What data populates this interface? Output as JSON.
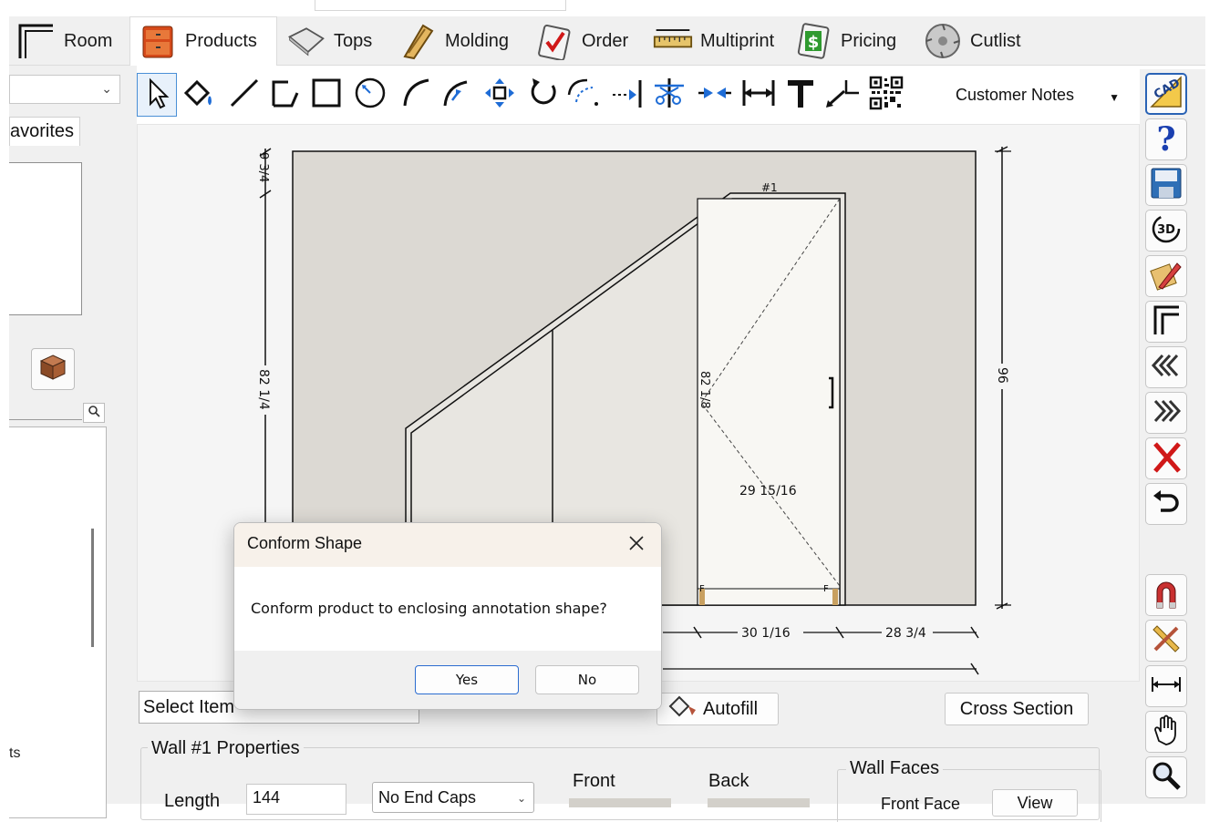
{
  "tabs": [
    {
      "label": "Room",
      "icon": "room-icon",
      "active": false
    },
    {
      "label": "Products",
      "icon": "products-cabinet-icon",
      "active": true
    },
    {
      "label": "Tops",
      "icon": "tops-icon",
      "active": false
    },
    {
      "label": "Molding",
      "icon": "molding-icon",
      "active": false
    },
    {
      "label": "Order",
      "icon": "order-clipboard-icon",
      "active": false
    },
    {
      "label": "Multiprint",
      "icon": "ruler-icon",
      "active": false
    },
    {
      "label": "Pricing",
      "icon": "pricing-dollar-icon",
      "active": false
    },
    {
      "label": "Cutlist",
      "icon": "saw-blade-icon",
      "active": false
    }
  ],
  "left_panel": {
    "favorites_tab": "avorites",
    "bottom_label": "ts"
  },
  "toolbar": {
    "notes_selected": "Customer Notes",
    "tools": [
      "select-arrow-icon",
      "paint-bucket-icon",
      "line-icon",
      "polyline-icon",
      "rectangle-icon",
      "circle-icon",
      "arc-icon",
      "arc-tangent-icon",
      "move-icon",
      "rotate-icon",
      "offset-icon",
      "extend-icon",
      "trim-icon",
      "join-icon",
      "dimension-icon",
      "text-icon",
      "leader-icon",
      "qr-code-icon"
    ]
  },
  "drawing": {
    "wall_label": "#1",
    "dim_left_top": "9 3/4",
    "dim_left": "82 1/4",
    "dim_right": "96",
    "dim_inner_height": "82 1/8",
    "dim_inner_width": "29 15/16",
    "dim_bottom_a": "30 1/16",
    "dim_bottom_b": "28 3/4",
    "corner_mark": "F",
    "colors": {
      "wall_fill": "#dcd9d3",
      "cabinet_fill": "#f8f7f3",
      "line": "#111111"
    }
  },
  "bottom": {
    "select_item": "Select Item",
    "autofill": "Autofill",
    "cross_section": "Cross Section",
    "props_title": "Wall #1 Properties",
    "length_label": "Length",
    "length_value": "144",
    "end_caps": "No End Caps",
    "front": "Front",
    "back": "Back",
    "wall_faces": "Wall Faces",
    "front_face": "Front Face",
    "view": "View"
  },
  "right_toolbar": [
    "cad-icon",
    "help-question-icon",
    "save-disk-icon",
    "3d-view-icon",
    "edit-pencil-icon",
    "wall-corner-icon",
    "previous-icon",
    "next-icon",
    "delete-x-icon",
    "undo-icon",
    "magnet-icon",
    "measure-pencil-icon",
    "dimension-arrows-icon",
    "hand-pan-icon",
    "zoom-icon"
  ],
  "dialog": {
    "title": "Conform Shape",
    "message": "Conform product to enclosing annotation shape?",
    "yes": "Yes",
    "no": "No"
  }
}
